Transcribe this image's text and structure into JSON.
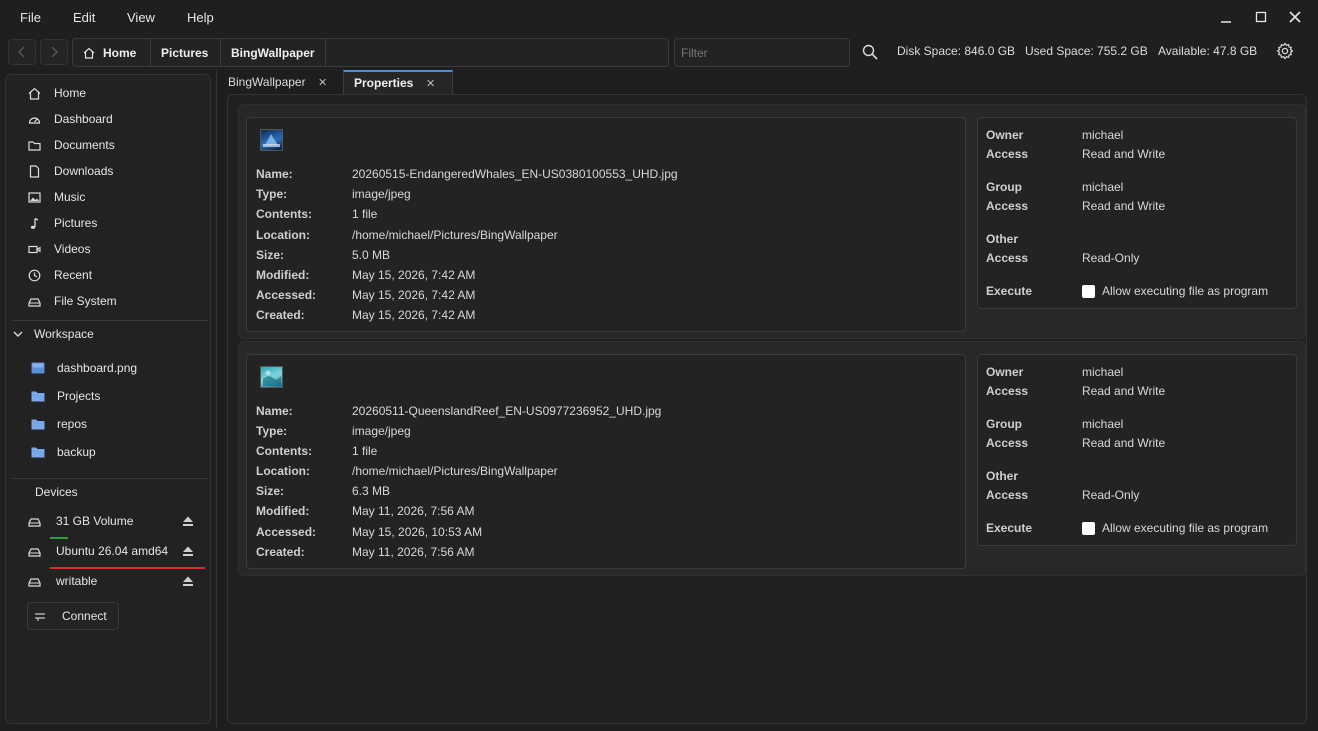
{
  "menu": [
    "File",
    "Edit",
    "View",
    "Help"
  ],
  "window": {
    "minimize": "—",
    "maximize": "☐",
    "close": "✕"
  },
  "breadcrumb": [
    {
      "label": "Home"
    },
    {
      "label": "Pictures"
    },
    {
      "label": "BingWallpaper"
    }
  ],
  "filter_placeholder": "Filter",
  "stats": {
    "disk": "Disk Space: 846.0 GB",
    "used": "Used Space: 755.2 GB",
    "available": "Available: 47.8 GB"
  },
  "sidebar": {
    "places": [
      {
        "label": "Home",
        "icon": "home-icon"
      },
      {
        "label": "Dashboard",
        "icon": "dashboard-icon"
      },
      {
        "label": "Documents",
        "icon": "folder-icon"
      },
      {
        "label": "Downloads",
        "icon": "file-icon"
      },
      {
        "label": "Music",
        "icon": "image-icon"
      },
      {
        "label": "Pictures",
        "icon": "music-note-icon"
      },
      {
        "label": "Videos",
        "icon": "video-icon"
      },
      {
        "label": "Recent",
        "icon": "clock-icon"
      },
      {
        "label": "File System",
        "icon": "drive-icon"
      }
    ],
    "workspace_title": "Workspace",
    "workspace": [
      {
        "label": "dashboard.png"
      },
      {
        "label": "Projects"
      },
      {
        "label": "repos"
      },
      {
        "label": "backup"
      }
    ],
    "devices_title": "Devices",
    "devices": [
      {
        "label": "31 GB Volume",
        "usage": 0.12,
        "bar_color": "#2e9e3a"
      },
      {
        "label": "Ubuntu 26.04 amd64",
        "usage": 0.97,
        "bar_color": "#d9302c"
      },
      {
        "label": "writable",
        "usage": 0,
        "bar_color": "#2e9e3a"
      }
    ],
    "connect_label": "Connect"
  },
  "tabs": [
    {
      "label": "BingWallpaper",
      "close": "✕"
    },
    {
      "label": "Properties",
      "close": "✕"
    }
  ],
  "labels": {
    "name": "Name:",
    "type": "Type:",
    "contents": "Contents:",
    "location": "Location:",
    "size": "Size:",
    "modified": "Modified:",
    "accessed": "Accessed:",
    "created": "Created:",
    "owner": "Owner",
    "access": "Access",
    "group": "Group",
    "other": "Other",
    "execute": "Execute",
    "execute_option": "Allow executing file as program"
  },
  "files": [
    {
      "name": "20260515-EndangeredWhales_EN-US0380100553_UHD.jpg",
      "type": "image/jpeg",
      "contents": "1 file",
      "location": "/home/michael/Pictures/BingWallpaper",
      "size": "5.0 MB",
      "modified": "May 15, 2026, 7:42 AM",
      "accessed": "May 15, 2026, 7:42 AM",
      "created": "May 15, 2026, 7:42 AM",
      "owner": "michael",
      "owner_access": "Read and Write",
      "group": "michael",
      "group_access": "Read and Write",
      "other_access": "Read-Only"
    },
    {
      "name": "20260511-QueenslandReef_EN-US0977236952_UHD.jpg",
      "type": "image/jpeg",
      "contents": "1 file",
      "location": "/home/michael/Pictures/BingWallpaper",
      "size": "6.3 MB",
      "modified": "May 11, 2026, 7:56 AM",
      "accessed": "May 15, 2026, 10:53 AM",
      "created": "May 11, 2026, 7:56 AM",
      "owner": "michael",
      "owner_access": "Read and Write",
      "group": "michael",
      "group_access": "Read and Write",
      "other_access": "Read-Only"
    }
  ]
}
